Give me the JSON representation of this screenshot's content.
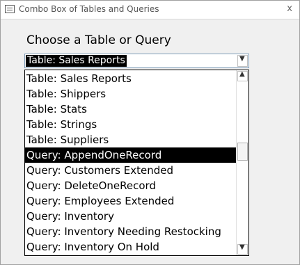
{
  "window": {
    "title": "Combo Box of Tables and Queries",
    "close_glyph": "x",
    "icon": "form-icon"
  },
  "form": {
    "prompt": "Choose a Table or Query",
    "combo": {
      "value": "Table: Sales Reports",
      "dropdown_glyph": "▼"
    },
    "list": {
      "items": [
        "Table: Sales Reports",
        "Table: Shippers",
        "Table: Stats",
        "Table: Strings",
        "Table: Suppliers",
        "Query: AppendOneRecord",
        "Query: Customers Extended",
        "Query: DeleteOneRecord",
        "Query: Employees Extended",
        "Query: Inventory",
        "Query: Inventory Needing Restocking",
        "Query: Inventory On Hold"
      ],
      "selected_item": "Query: AppendOneRecord",
      "scroll_up_glyph": "▲",
      "scroll_down_glyph": "▼"
    }
  },
  "colors": {
    "highlight_bg": "#000000",
    "highlight_fg": "#ffffff",
    "window_bg": "#f0f0f0"
  }
}
